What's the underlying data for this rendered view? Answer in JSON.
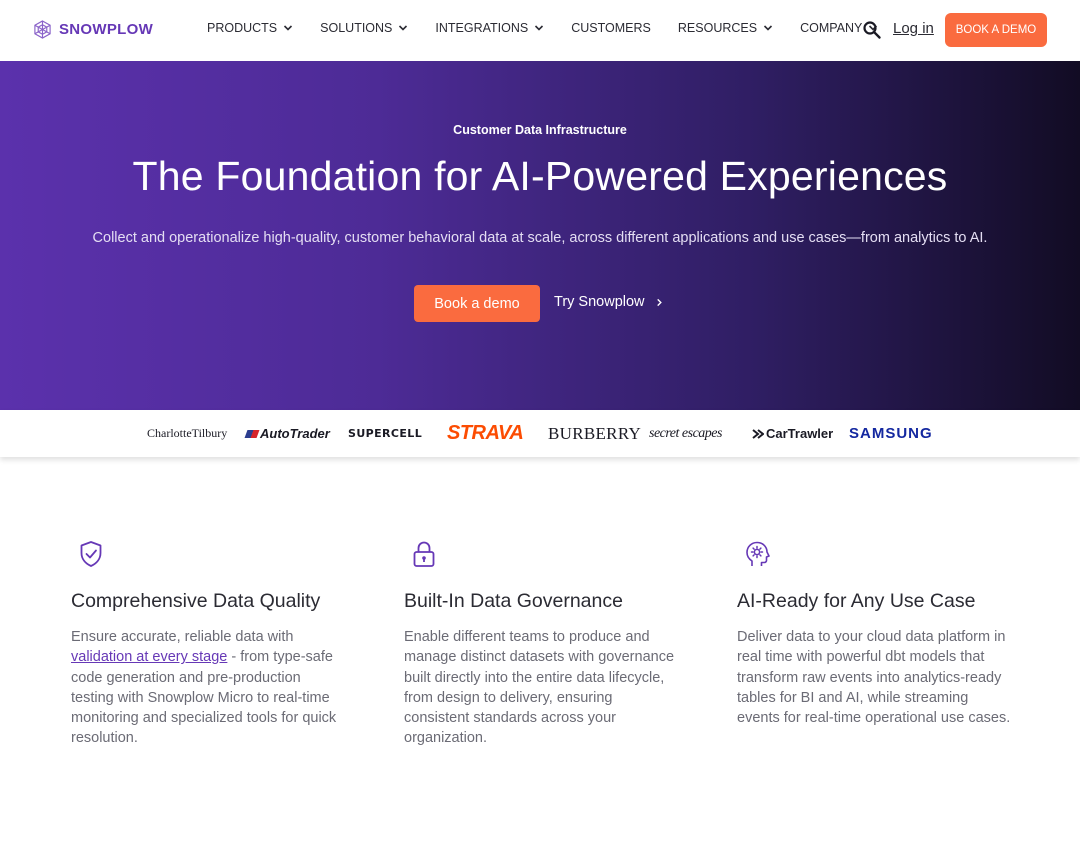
{
  "nav": {
    "logo_text": "SNOWPLOW",
    "items": [
      {
        "label": "PRODUCTS",
        "has_dropdown": true
      },
      {
        "label": "SOLUTIONS",
        "has_dropdown": true
      },
      {
        "label": "INTEGRATIONS",
        "has_dropdown": true
      },
      {
        "label": "CUSTOMERS",
        "has_dropdown": false
      },
      {
        "label": "RESOURCES",
        "has_dropdown": true
      },
      {
        "label": "COMPANY",
        "has_dropdown": true
      }
    ],
    "login_label": "Log in",
    "book_demo_label": "BOOK A DEMO"
  },
  "hero": {
    "eyebrow": "Customer Data Infrastructure",
    "title": "The Foundation for AI-Powered Experiences",
    "subtitle": "Collect and operationalize high-quality, customer behavioral data at scale, across different applications and use cases—from analytics to AI.",
    "primary_cta": "Book a demo",
    "secondary_cta": "Try Snowplow"
  },
  "customer_logos": [
    "CharlotteTilbury",
    "AutoTrader",
    "SUPERCELL",
    "STRAVA",
    "BURBERRY",
    "secret escapes",
    "CarTrawler",
    "SAMSUNG"
  ],
  "features": [
    {
      "icon": "shield-check-icon",
      "title": "Comprehensive Data Quality",
      "text_before": "Ensure accurate, reliable data with ",
      "link": "validation at every stage",
      "text_after": " - from type-safe code generation and pre-production testing with Snowplow Micro to real-time monitoring and specialized tools for quick resolution."
    },
    {
      "icon": "lock-icon",
      "title": "Built-In Data Governance",
      "text": "Enable different teams to produce and manage distinct datasets with governance built directly into the entire data lifecycle, from design to delivery, ensuring consistent standards across your organization."
    },
    {
      "icon": "ai-head-icon",
      "title": "AI-Ready for Any Use Case",
      "text": "Deliver data to your cloud data platform in real time with powerful dbt models that transform raw events into analytics-ready tables for BI and AI, while streaming events for real-time operational use cases."
    }
  ],
  "colors": {
    "brand_purple": "#6638b6",
    "accent_orange": "#fa6b3f"
  }
}
